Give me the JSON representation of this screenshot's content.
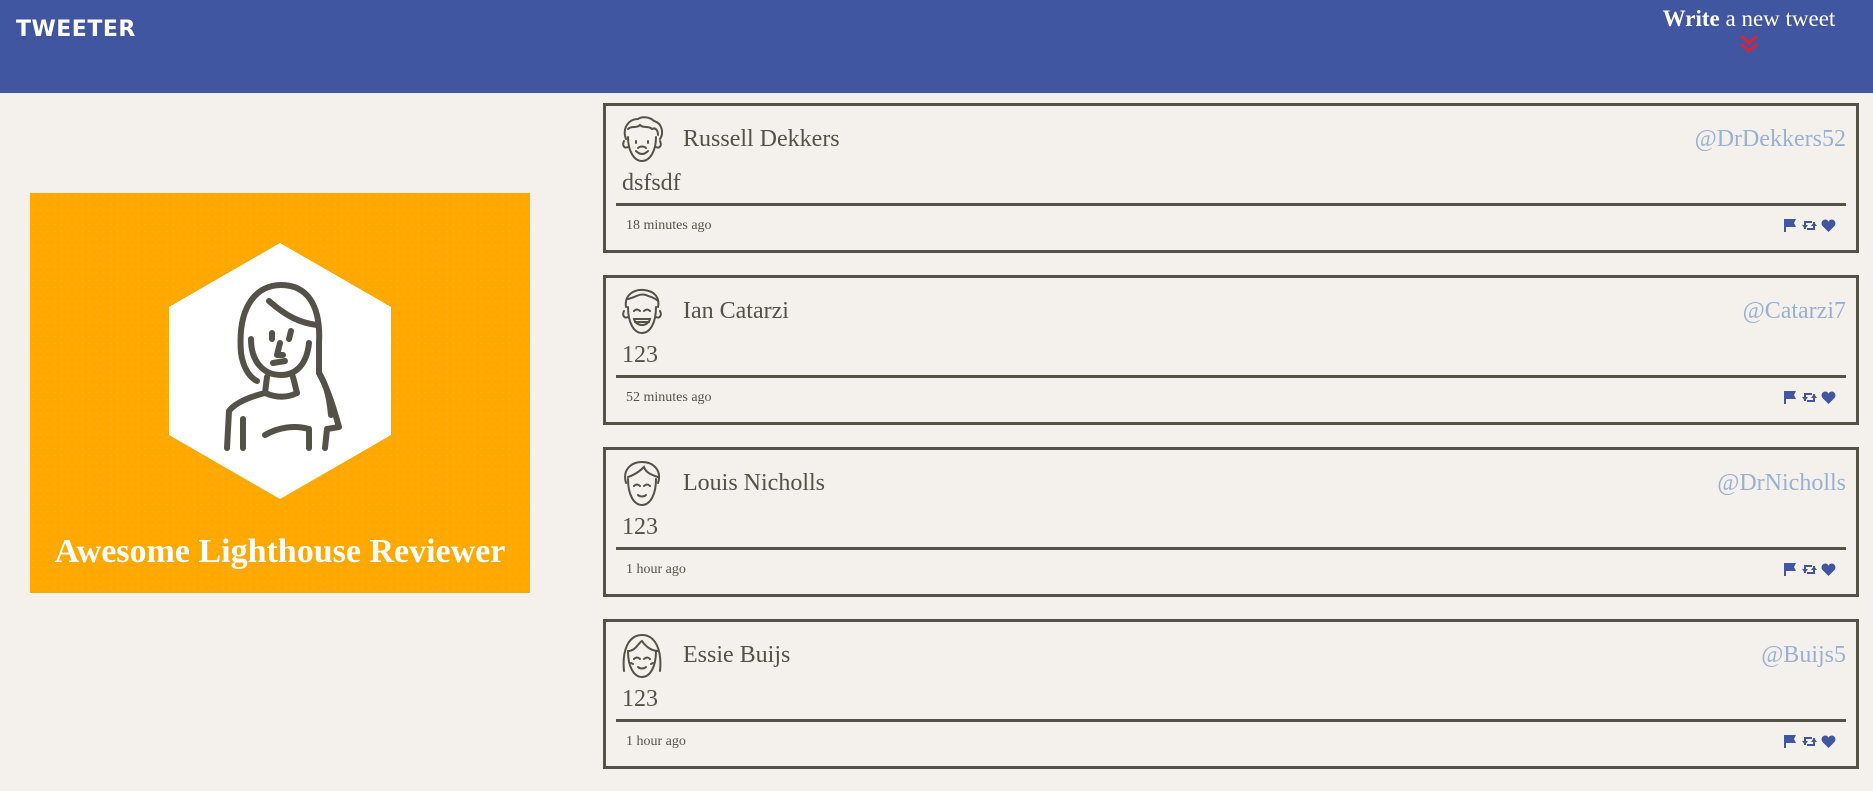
{
  "nav": {
    "brand": "TWEETER",
    "compose_bold": "Write",
    "compose_rest": " a new tweet",
    "compose_icon": "double-chevron-down-icon",
    "compose_icon_color": "#d8233a"
  },
  "profile": {
    "name": "Awesome Lighthouse Reviewer",
    "card_color": "#ffa800",
    "avatar_icon": "woman-avatar-icon"
  },
  "feed": {
    "tweets": [
      {
        "name": "Russell Dekkers",
        "handle": "@DrDekkers52",
        "content": "dsfsdf",
        "time": "18 minutes ago",
        "avatar_icon": "curly-hair-avatar-icon"
      },
      {
        "name": "Ian Catarzi",
        "handle": "@Catarzi7",
        "content": "123",
        "time": "52 minutes ago",
        "avatar_icon": "smiling-man-avatar-icon"
      },
      {
        "name": "Louis Nicholls",
        "handle": "@DrNicholls",
        "content": "123",
        "time": "1 hour ago",
        "avatar_icon": "man-avatar-icon"
      },
      {
        "name": "Essie Buijs",
        "handle": "@Buijs5",
        "content": "123",
        "time": "1 hour ago",
        "avatar_icon": "woman-bangs-avatar-icon"
      }
    ],
    "action_icons": [
      "flag-icon",
      "retweet-icon",
      "heart-icon"
    ],
    "action_color": "#4056a1",
    "handle_color": "#9ab0d3"
  }
}
